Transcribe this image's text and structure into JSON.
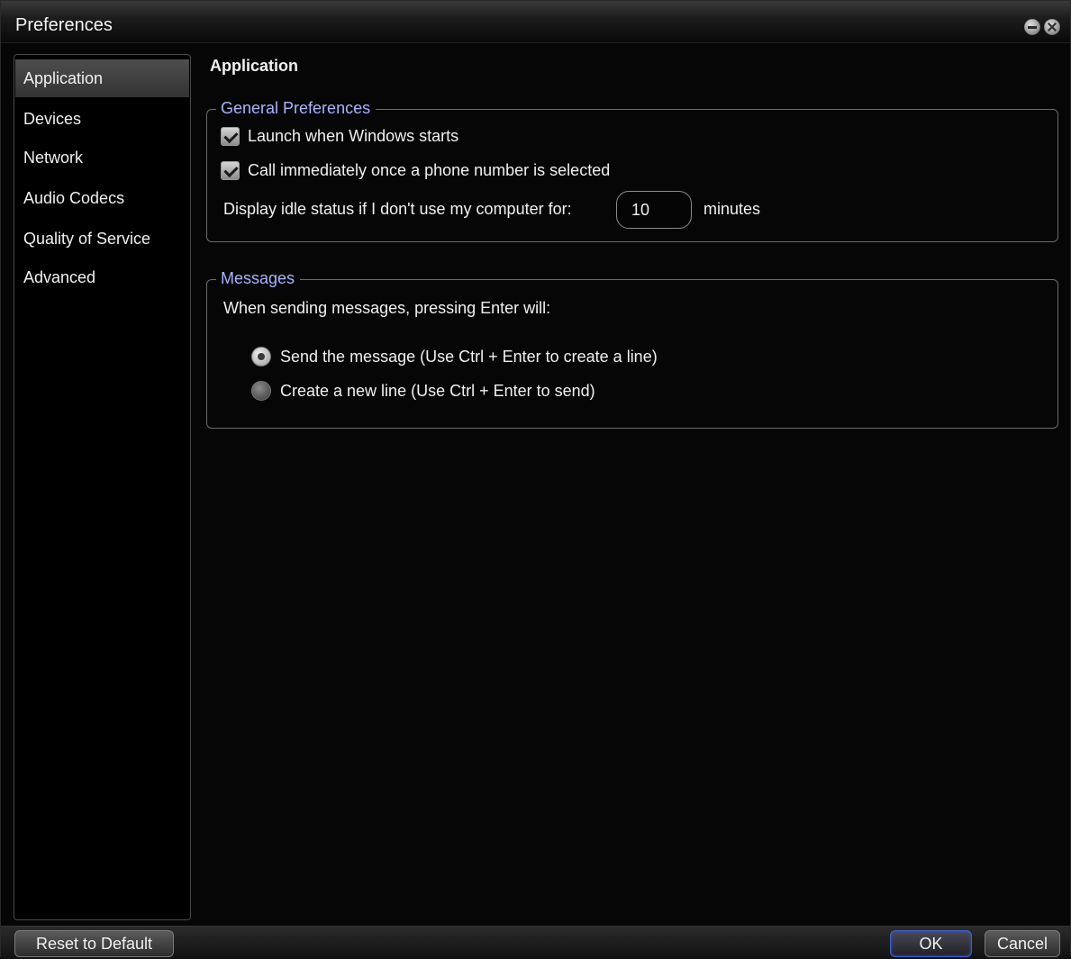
{
  "window": {
    "title": "Preferences"
  },
  "sidebar": {
    "items": [
      {
        "label": "Application",
        "selected": true
      },
      {
        "label": "Devices",
        "selected": false
      },
      {
        "label": "Network",
        "selected": false
      },
      {
        "label": "Audio Codecs",
        "selected": false
      },
      {
        "label": "Quality of Service",
        "selected": false
      },
      {
        "label": "Advanced",
        "selected": false
      }
    ]
  },
  "main": {
    "title": "Application",
    "general": {
      "legend": "General Preferences",
      "launch_label": "Launch when Windows starts",
      "launch_checked": true,
      "call_label": "Call immediately once a phone number is selected",
      "call_checked": true,
      "idle_label": "Display idle status if I don't use my computer for:",
      "idle_value": "10",
      "idle_unit": "minutes"
    },
    "messages": {
      "legend": "Messages",
      "prompt": "When sending messages, pressing Enter will:",
      "option_send": "Send the message (Use Ctrl + Enter to create a line)",
      "option_send_selected": true,
      "option_newline": "Create a new line (Use Ctrl + Enter to send)",
      "option_newline_selected": false
    }
  },
  "buttons": {
    "reset": "Reset to Default",
    "ok": "OK",
    "cancel": "Cancel"
  },
  "colors": {
    "legend_text": "#a9b4ff",
    "background": "#060606",
    "ok_border": "#3f5fd0"
  }
}
